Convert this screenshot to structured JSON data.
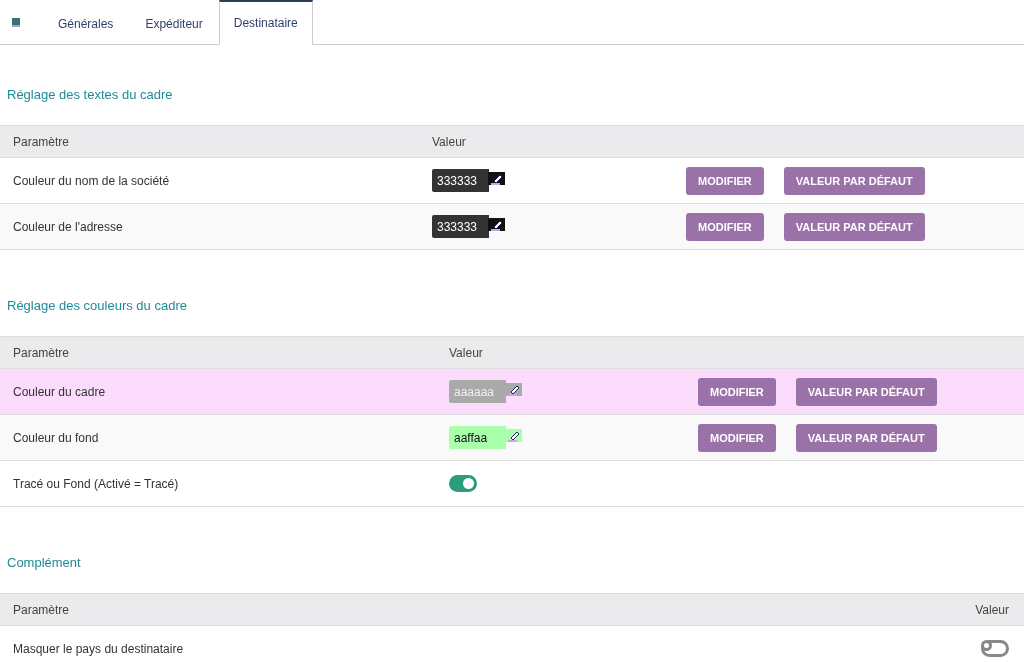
{
  "tabs": [
    {
      "label": "Générales",
      "selected": false
    },
    {
      "label": "Expéditeur",
      "selected": false
    },
    {
      "label": "Destinataire",
      "selected": true
    }
  ],
  "sections": [
    {
      "title": "Réglage des textes du cadre",
      "columns": [
        "Paramètre",
        "Valeur"
      ],
      "rows": [
        {
          "kind": "color",
          "label": "Couleur du nom de la société",
          "value": "333333",
          "color": "#333333",
          "highlighted": false,
          "buttons": [
            "MODIFIER",
            "VALEUR PAR DÉFAUT"
          ]
        },
        {
          "kind": "color",
          "label": "Couleur de l'adresse",
          "value": "333333",
          "color": "#333333",
          "highlighted": false,
          "buttons": [
            "MODIFIER",
            "VALEUR PAR DÉFAUT"
          ]
        }
      ]
    },
    {
      "title": "Réglage des couleurs du cadre",
      "columns": [
        "Paramètre",
        "Valeur"
      ],
      "rows": [
        {
          "kind": "color",
          "label": "Couleur du cadre",
          "value": "aaaaaa",
          "color": "#aaaaaa",
          "highlighted": true,
          "buttons": [
            "MODIFIER",
            "VALEUR PAR DÉFAUT"
          ]
        },
        {
          "kind": "color",
          "label": "Couleur du fond",
          "value": "aaffaa",
          "color": "#aaffaa",
          "highlighted": false,
          "buttons": [
            "MODIFIER",
            "VALEUR PAR DÉFAUT"
          ]
        },
        {
          "kind": "switch",
          "label": "Tracé ou Fond (Activé = Tracé)",
          "on": true,
          "highlighted": false
        }
      ]
    },
    {
      "title": "Complément",
      "columns": [
        "Paramètre",
        "Valeur"
      ],
      "rows": [
        {
          "kind": "switch",
          "label": "Masquer le pays du destinataire",
          "on": false,
          "highlighted": false
        }
      ]
    }
  ]
}
